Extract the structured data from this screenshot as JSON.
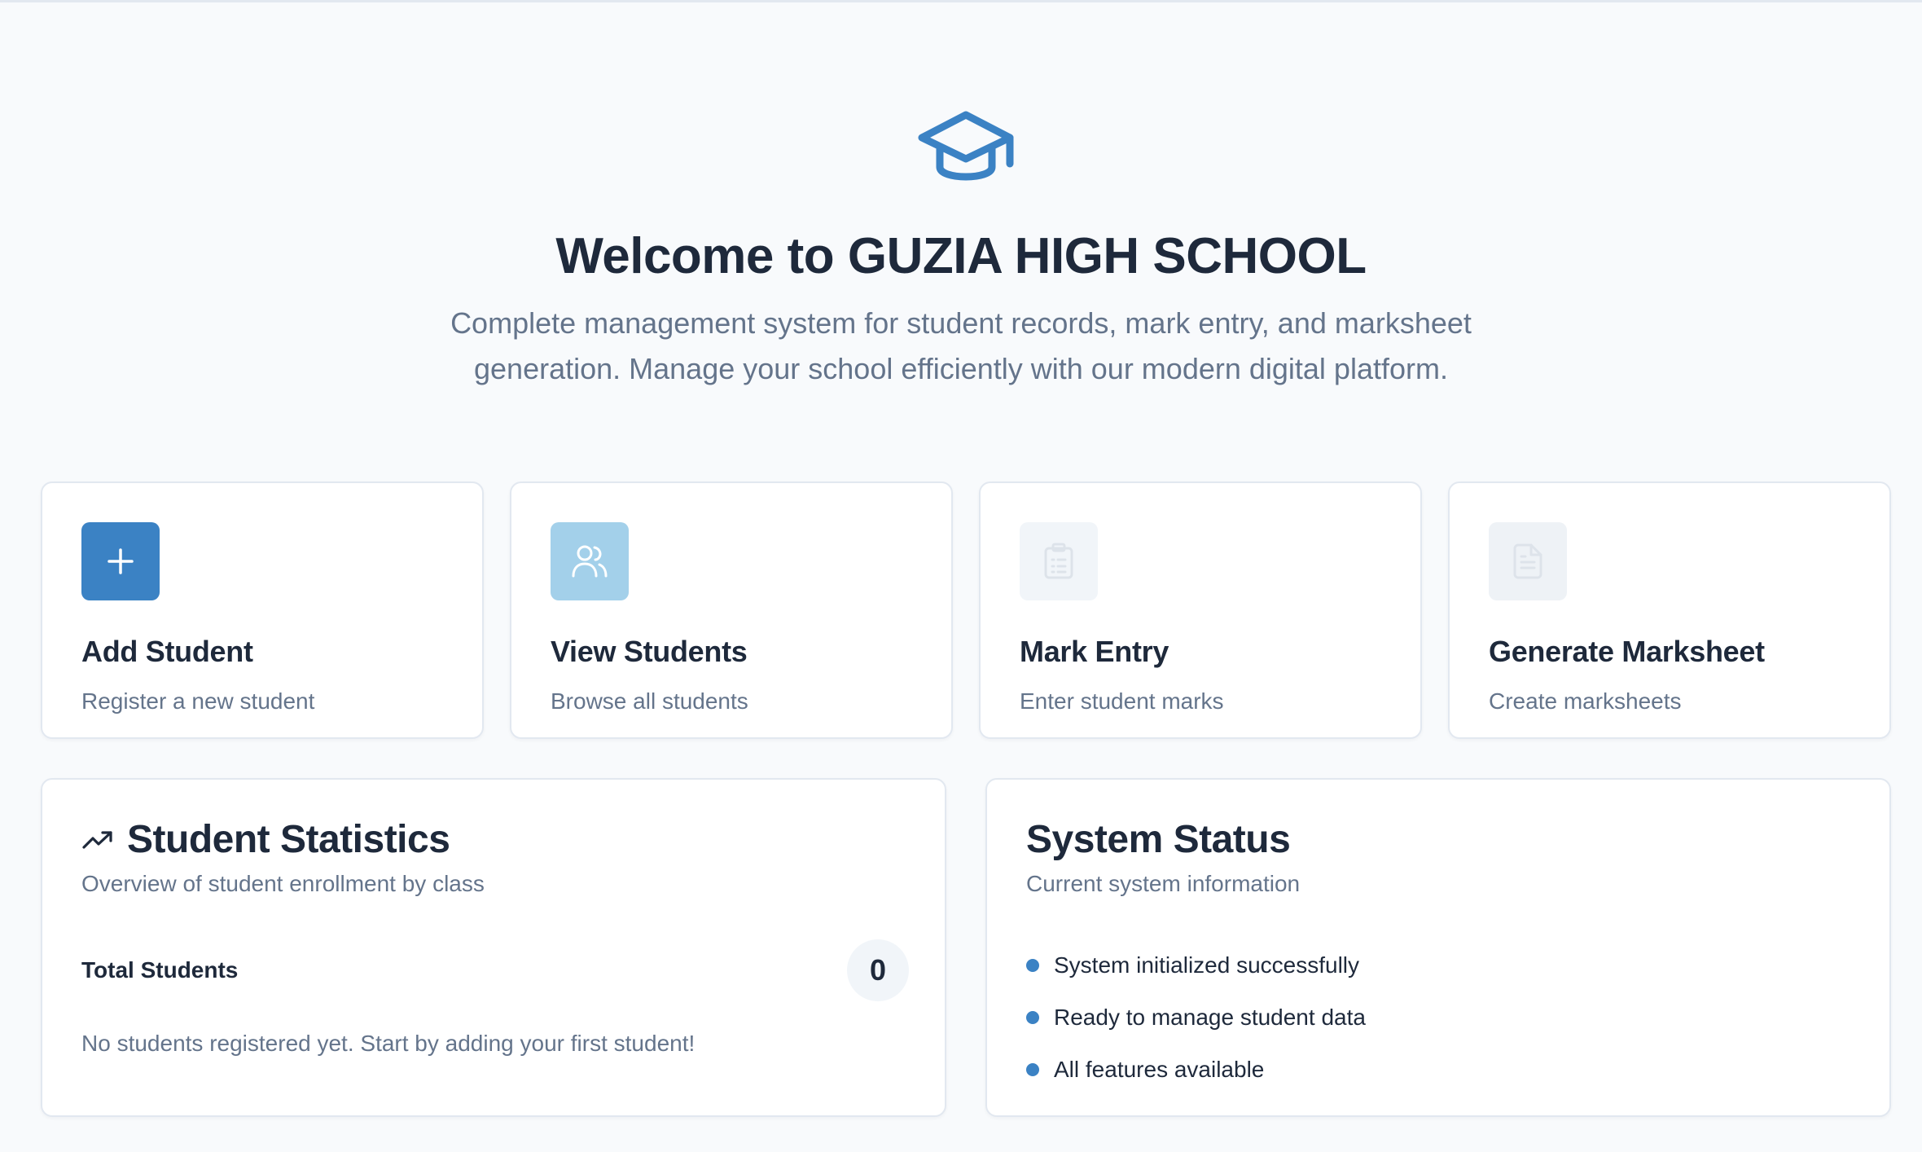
{
  "hero": {
    "icon": "graduation-cap-icon",
    "title": "Welcome to GUZIA HIGH SCHOOL",
    "subtitle_line1": "Complete management system for student records, mark entry, and marksheet",
    "subtitle_line2": "generation. Manage your school efficiently with our modern digital platform."
  },
  "actions": [
    {
      "icon": "plus-icon",
      "title": "Add Student",
      "description": "Register a new student",
      "icon_bg": "#3b82c4",
      "icon_color": "#ffffff"
    },
    {
      "icon": "users-icon",
      "title": "View Students",
      "description": "Browse all students",
      "icon_bg": "#a3d0ea",
      "icon_color": "#ffffff"
    },
    {
      "icon": "clipboard-icon",
      "title": "Mark Entry",
      "description": "Enter student marks",
      "icon_bg": "#f1f5f9",
      "icon_color": "#dde3ea"
    },
    {
      "icon": "file-text-icon",
      "title": "Generate Marksheet",
      "description": "Create marksheets",
      "icon_bg": "#eef2f6",
      "icon_color": "#dde3ea"
    }
  ],
  "statistics": {
    "icon": "trending-up-icon",
    "title": "Student Statistics",
    "subtitle": "Overview of student enrollment by class",
    "total_label": "Total Students",
    "total_value": "0",
    "empty_message": "No students registered yet. Start by adding your first student!"
  },
  "system_status": {
    "title": "System Status",
    "subtitle": "Current system information",
    "items": [
      "System initialized successfully",
      "Ready to manage student data",
      "All features available"
    ]
  },
  "colors": {
    "accent": "#3b82c4",
    "background": "#f8fafc",
    "heading": "#1e293b",
    "muted": "#64748b"
  }
}
